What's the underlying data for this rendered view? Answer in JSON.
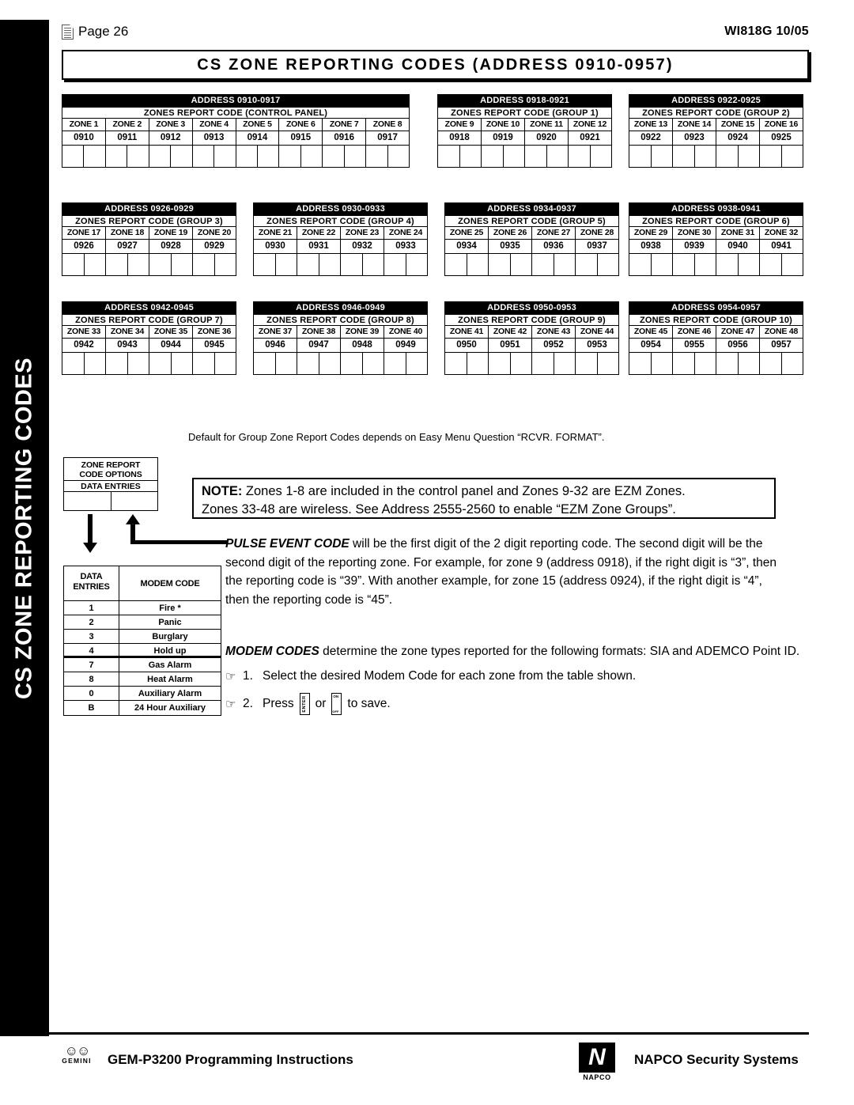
{
  "sidebar": {
    "label": "CS ZONE REPORTING CODES"
  },
  "header": {
    "page_label": "Page 26",
    "doc_revision": "WI818G  10/05",
    "doc_icon": "document-icon"
  },
  "title": {
    "text": "CS ZONE REPORTING CODES (ADDRESS 0910-0957)"
  },
  "address_tables": [
    {
      "head": "ADDRESS 0910-0917",
      "sub": "ZONES REPORT CODE (CONTROL PANEL)",
      "zones": [
        "ZONE 1",
        "ZONE 2",
        "ZONE 3",
        "ZONE 4",
        "ZONE 5",
        "ZONE 6",
        "ZONE 7",
        "ZONE 8"
      ],
      "addresses": [
        "0910",
        "0911",
        "0912",
        "0913",
        "0914",
        "0915",
        "0916",
        "0917"
      ]
    },
    {
      "head": "ADDRESS 0918-0921",
      "sub": "ZONES REPORT CODE (GROUP 1)",
      "zones": [
        "ZONE 9",
        "ZONE 10",
        "ZONE 11",
        "ZONE 12"
      ],
      "addresses": [
        "0918",
        "0919",
        "0920",
        "0921"
      ]
    },
    {
      "head": "ADDRESS 0922-0925",
      "sub": "ZONES REPORT CODE (GROUP 2)",
      "zones": [
        "ZONE 13",
        "ZONE 14",
        "ZONE 15",
        "ZONE 16"
      ],
      "addresses": [
        "0922",
        "0923",
        "0924",
        "0925"
      ]
    },
    {
      "head": "ADDRESS 0926-0929",
      "sub": "ZONES REPORT CODE (GROUP 3)",
      "zones": [
        "ZONE 17",
        "ZONE 18",
        "ZONE 19",
        "ZONE 20"
      ],
      "addresses": [
        "0926",
        "0927",
        "0928",
        "0929"
      ]
    },
    {
      "head": "ADDRESS 0930-0933",
      "sub": "ZONES REPORT CODE (GROUP 4)",
      "zones": [
        "ZONE 21",
        "ZONE 22",
        "ZONE 23",
        "ZONE 24"
      ],
      "addresses": [
        "0930",
        "0931",
        "0932",
        "0933"
      ]
    },
    {
      "head": "ADDRESS 0934-0937",
      "sub": "ZONES REPORT CODE (GROUP 5)",
      "zones": [
        "ZONE 25",
        "ZONE 26",
        "ZONE 27",
        "ZONE 28"
      ],
      "addresses": [
        "0934",
        "0935",
        "0936",
        "0937"
      ]
    },
    {
      "head": "ADDRESS 0938-0941",
      "sub": "ZONES REPORT CODE (GROUP 6)",
      "zones": [
        "ZONE 29",
        "ZONE 30",
        "ZONE 31",
        "ZONE 32"
      ],
      "addresses": [
        "0938",
        "0939",
        "0940",
        "0941"
      ]
    },
    {
      "head": "ADDRESS 0942-0945",
      "sub": "ZONES REPORT CODE (GROUP 7)",
      "zones": [
        "ZONE 33",
        "ZONE 34",
        "ZONE 35",
        "ZONE 36"
      ],
      "addresses": [
        "0942",
        "0943",
        "0944",
        "0945"
      ]
    },
    {
      "head": "ADDRESS 0946-0949",
      "sub": "ZONES REPORT CODE (GROUP 8)",
      "zones": [
        "ZONE 37",
        "ZONE 38",
        "ZONE 39",
        "ZONE 40"
      ],
      "addresses": [
        "0946",
        "0947",
        "0948",
        "0949"
      ]
    },
    {
      "head": "ADDRESS 0950-0953",
      "sub": "ZONES REPORT CODE (GROUP 9)",
      "zones": [
        "ZONE 41",
        "ZONE 42",
        "ZONE 43",
        "ZONE 44"
      ],
      "addresses": [
        "0950",
        "0951",
        "0952",
        "0953"
      ]
    },
    {
      "head": "ADDRESS 0954-0957",
      "sub": "ZONES REPORT CODE (GROUP 10)",
      "zones": [
        "ZONE 45",
        "ZONE 46",
        "ZONE 47",
        "ZONE 48"
      ],
      "addresses": [
        "0954",
        "0955",
        "0956",
        "0957"
      ]
    }
  ],
  "default_line": "Default for Group Zone Report Codes depends on Easy Menu Question “RCVR. FORMAT”.",
  "note_box": {
    "label": "NOTE:",
    "line1": " Zones 1-8 are included in the control panel and Zones 9-32 are EZM Zones.",
    "line2": "Zones 33-48 are wireless.  See Address 2555-2560 to enable “EZM Zone Groups”."
  },
  "legend": {
    "title_line1": "ZONE REPORT",
    "title_line2": "CODE OPTIONS",
    "subtitle": "DATA ENTRIES"
  },
  "modem_table": {
    "col1_line1": "DATA",
    "col1_line2": "ENTRIES",
    "col2": "MODEM CODE",
    "rows": [
      {
        "entry": "1",
        "code": "Fire *"
      },
      {
        "entry": "2",
        "code": "Panic"
      },
      {
        "entry": "3",
        "code": "Burglary"
      },
      {
        "entry": "4",
        "code": "Hold up"
      },
      {
        "entry": "7",
        "code": "Gas Alarm"
      },
      {
        "entry": "8",
        "code": "Heat Alarm"
      },
      {
        "entry": "0",
        "code": "Auxiliary Alarm"
      },
      {
        "entry": "B",
        "code": "24 Hour Auxiliary"
      }
    ]
  },
  "pulse_paragraph": {
    "lead": "PULSE EVENT CODE",
    "body": " will be the first digit of the 2 digit reporting code.  The second digit will be the second digit of the reporting zone.  For example, for zone 9 (address 0918), if the right digit is “3”, then the reporting code is “39”.  With another example, for zone 15 (address 0924), if the right digit is “4”, then the reporting code is “45”."
  },
  "modem_paragraph": {
    "lead": "MODEM CODES",
    "body": " determine the zone types reported for the following formats: SIA and ADEMCO Point ID."
  },
  "steps": [
    {
      "num": "1.",
      "text": "Select the desired Modem Code for each zone from the table shown."
    },
    {
      "num": "2.",
      "text_before": "Press",
      "key1": "ENTER",
      "conjunction": "or",
      "key2_on": "ON",
      "key2_off": "OFF",
      "text_after": "to save."
    }
  ],
  "footer": {
    "gemini_word": "GEMINI",
    "left_text": "GEM-P3200 Programming Instructions",
    "napco_letter": "N",
    "napco_word": "NAPCO",
    "right_text": "NAPCO Security Systems"
  }
}
